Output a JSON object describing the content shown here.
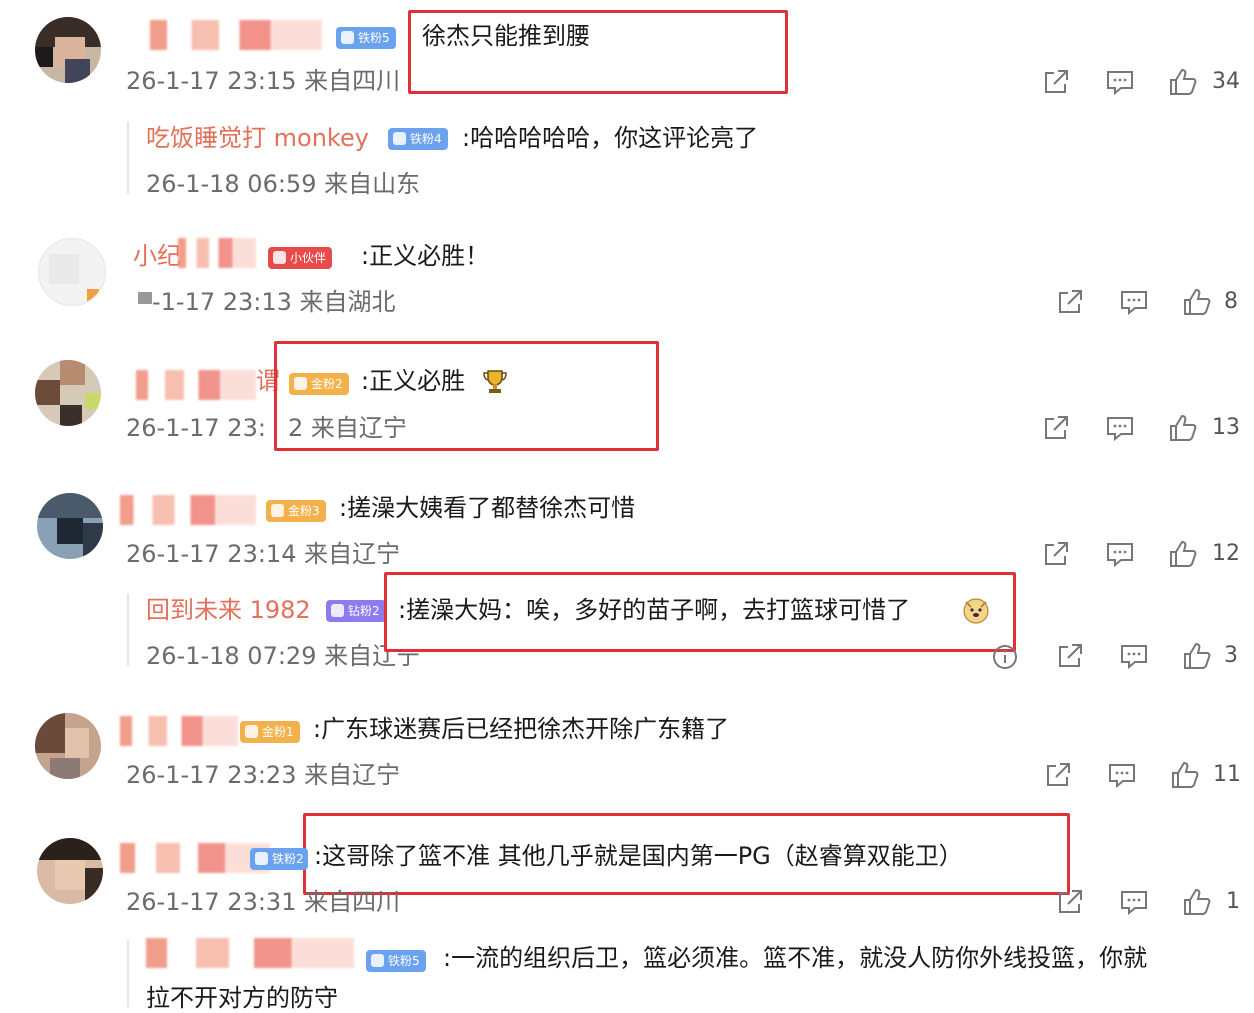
{
  "comments": [
    {
      "text": "徐杰只能推到腰",
      "badge": "铁粉5",
      "meta": "26-1-17 23:15 来自四川",
      "likes": "34"
    },
    {
      "reply_name": "吃饭睡觉打 monkey",
      "badge": "铁粉4",
      "text": ":哈哈哈哈哈，你这评论亮了",
      "meta": "26-1-18 06:59 来自山东"
    },
    {
      "name_partial": "小纪",
      "badge": "小伙伴",
      "text": ":正义必胜！",
      "meta": "-1-17 23:13 来自湖北",
      "likes": "8"
    },
    {
      "name_partial": "谓",
      "badge": "金粉2",
      "text": ":正义必胜",
      "meta": "26-1-17 23:",
      "meta2": "2 来自辽宁",
      "likes": "13"
    },
    {
      "badge": "金粉3",
      "text": ":搓澡大姨看了都替徐杰可惜",
      "meta": "26-1-17 23:14 来自辽宁",
      "likes": "12"
    },
    {
      "reply_name": "回到未来 1982",
      "badge": "钻粉2",
      "text": ":搓澡大妈：唉，多好的苗子啊，去打篮球可惜了",
      "meta": "26-1-18 07:29 来自辽宁",
      "likes": "3"
    },
    {
      "badge": "金粉1",
      "text": ":广东球迷赛后已经把徐杰开除广东籍了",
      "meta": "26-1-17 23:23 来自辽宁",
      "likes": "11"
    },
    {
      "badge": "铁粉2",
      "text": ":这哥除了篮不准 其他几乎就是国内第一PG（赵睿算双能卫）",
      "meta": "26-1-17 23:31 来自四川",
      "likes": "1"
    },
    {
      "badge": "铁粉5",
      "text": ":一流的组织后卫，篮必须准。篮不准，就没人防你外线投篮，你就",
      "text2": "拉不开对方的防守"
    }
  ],
  "icons": {
    "share": "share-icon",
    "comment": "comment-icon",
    "like": "thumbs-up-icon",
    "trophy": "trophy-emoji",
    "doge": "doge-emoji",
    "crown": "crown-icon"
  },
  "colors": {
    "highlight": "#e0303a",
    "reply_name": "#e4705a",
    "meta": "#6b6b6b"
  }
}
